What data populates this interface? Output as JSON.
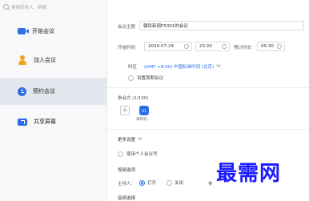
{
  "sidebar": {
    "search_placeholder": "搜索联系人、群聊",
    "items": [
      {
        "label": "开始会议",
        "icon": "video-camera-icon"
      },
      {
        "label": "加入会议",
        "icon": "user-icon"
      },
      {
        "label": "预约会议",
        "icon": "clock-icon",
        "active": true
      },
      {
        "label": "共享屏幕",
        "icon": "share-screen-icon"
      }
    ]
  },
  "form": {
    "topic_label": "会议主题",
    "topic_value": "骥目新闻P5301的会议",
    "start_label": "开始时间",
    "start_date": "2024-07-24",
    "start_time": "23:20",
    "duration_label": "预计时长",
    "duration_value": "00:30",
    "timezone_label": "时区",
    "timezone_value": "(GMT +8:00) 中国标准时间 (北京)",
    "recurring_label": "设置周期会议",
    "participants_label": "参会方 (1/100)",
    "participant_avatar_text": "01",
    "participant_name": "骥目新...",
    "more_settings_label": "更多设置",
    "personal_id_label": "使用个人会议号",
    "video_options_label": "视频选项",
    "host_label": "主持人:",
    "host_on_label": "打开",
    "host_off_label": "关闭",
    "participant_video_label": "参",
    "audio_options_label": "音频选择"
  },
  "watermark": "最需网",
  "colors": {
    "accent": "#2c6fe6",
    "sidebar_bg": "#f7f8fa",
    "active_bg": "#e4e8ee"
  }
}
